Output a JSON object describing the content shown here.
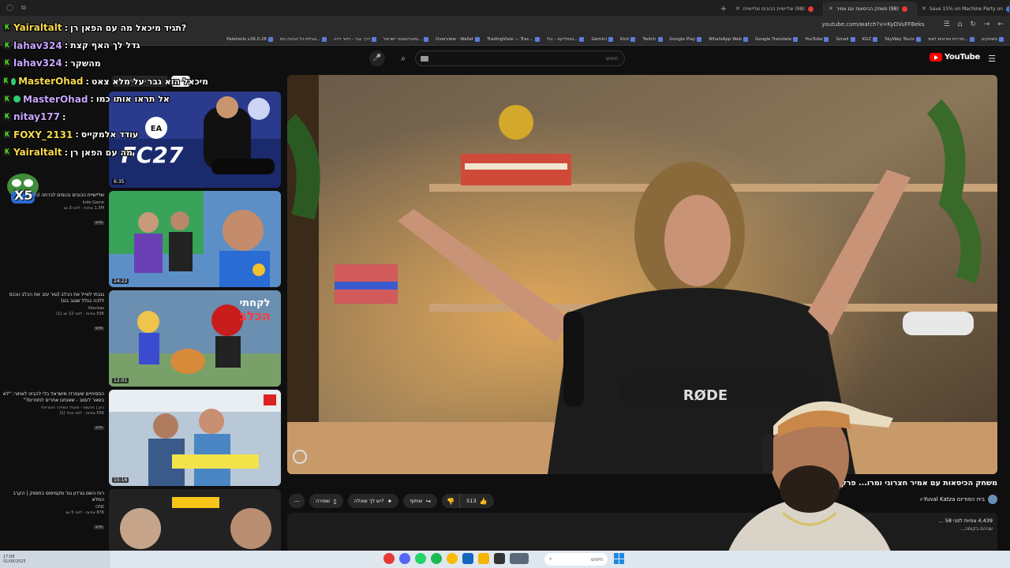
{
  "browser": {
    "tabs": [
      {
        "label": "(98) שליישיית הכובים שליישיית",
        "active": false
      },
      {
        "label": "(98) משחק הכיסאות עם אמיר",
        "active": true
      },
      {
        "label": "Save 15% on Machine Party on",
        "active": false
      }
    ],
    "url": "youtube.com/watch?v=KyDVuFFBeks",
    "bookmarks": [
      "Paletools v26.0.28",
      "טבלת כל הבינה המ...",
      "דרך גבר - דיוור דייה",
      "סינכרונסטר ישראל...",
      "Overview · Wallet",
      "TradingView — Trac...",
      "נטפליקס - בול...",
      "Gemini",
      "Kick",
      "Twitch",
      "Google Play",
      "WhatsApp Web",
      "Google Translate",
      "YouTube",
      "Gmail",
      "KGZ",
      "SkyWay Tours",
      "סדרות וסרטים לצפי...",
      "משחקים"
    ]
  },
  "header": {
    "logo_text": "YouTube",
    "search_placeholder": "חיפוש"
  },
  "chips": [
    "הכול",
    "הועלה על ידי בית המוד..."
  ],
  "video": {
    "title": "משחק הכיסאות עם אמיר חצרוני ומרו... פרק 9",
    "channel": "בית הפודיום Yuval Katza-ו",
    "like_count": "513",
    "views_text": "4,439 צפיות לפני 58 ...",
    "sub_text": "שניהם בקומה..."
  },
  "actions": {
    "share": "שיתוף",
    "ask": "יש לך שאלה?",
    "save": "שמירה"
  },
  "recommended": [
    {
      "title": "",
      "channel": "",
      "views": "",
      "duration": "6:35"
    },
    {
      "title": "שליישיית הכובים נכנסים לברחה (נעלו אותנו)",
      "channel": "Inde Game",
      "views": "1.5M צפיות · לפני 3 שנ",
      "badge": "חדש",
      "duration": "24:22"
    },
    {
      "title": "גנבתי לאייל את הכלב (טור עזב את הכלב ונכנס ללכה בגלל שגנב בנו)",
      "channel": "Vlavisas",
      "views": "53K צפיות · לפני 12 שנ (1)",
      "badge": "חדש",
      "duration": "12:01"
    },
    {
      "title": "הפסיחיים שעפרדו מישראל בלי להביט לאחור: \"לא בשאר לעזוב - שאנחנו אחרים לחוזרים?\"",
      "channel": "כאן | חדשות - תאגיד השידור הישראלי",
      "views": "55K צפיות · לפני אחד (1)",
      "badge": "חדש",
      "duration": "15:16"
    },
    {
      "title": "רוח השם גורדון נגד מקסימוס בחוסוק | הקרב המלא",
      "channel": "ONE",
      "views": "87K צפיות · לפני 5 שנ",
      "badge": "חדש",
      "duration": ""
    }
  ],
  "chat": [
    {
      "user": "Yairaltalt",
      "color": "#f7d94c",
      "text": "תגיד מיכאל מה עם הפאן רן?"
    },
    {
      "user": "lahav324",
      "color": "#c9a6ff",
      "text": "גדל לך האף קצת"
    },
    {
      "user": "lahav324",
      "color": "#c9a6ff",
      "text": "מהשקר"
    },
    {
      "user": "MasterOhad",
      "color": "#f7d94c",
      "text": "מיכאל הוא גבר על מלא צאט"
    },
    {
      "user": "MasterOhad",
      "color": "#c9a6ff",
      "text": "אל תראו אותו כמו"
    },
    {
      "user": "nitay177",
      "color": "#c9a6ff",
      "text": ""
    },
    {
      "user": "FOXY_2131",
      "color": "#f7d94c",
      "text": "עודד אלמקייס"
    },
    {
      "user": "Yairaltalt",
      "color": "#f7d94c",
      "text": "מה עם הפאן רן"
    }
  ],
  "emote_text": "X5",
  "taskbar": {
    "time": "17:08",
    "date": "01/06/2025",
    "search_label": "חיפוש"
  },
  "colors": {
    "kick_green": "#53fc18",
    "youtube_red": "#ff0000"
  }
}
